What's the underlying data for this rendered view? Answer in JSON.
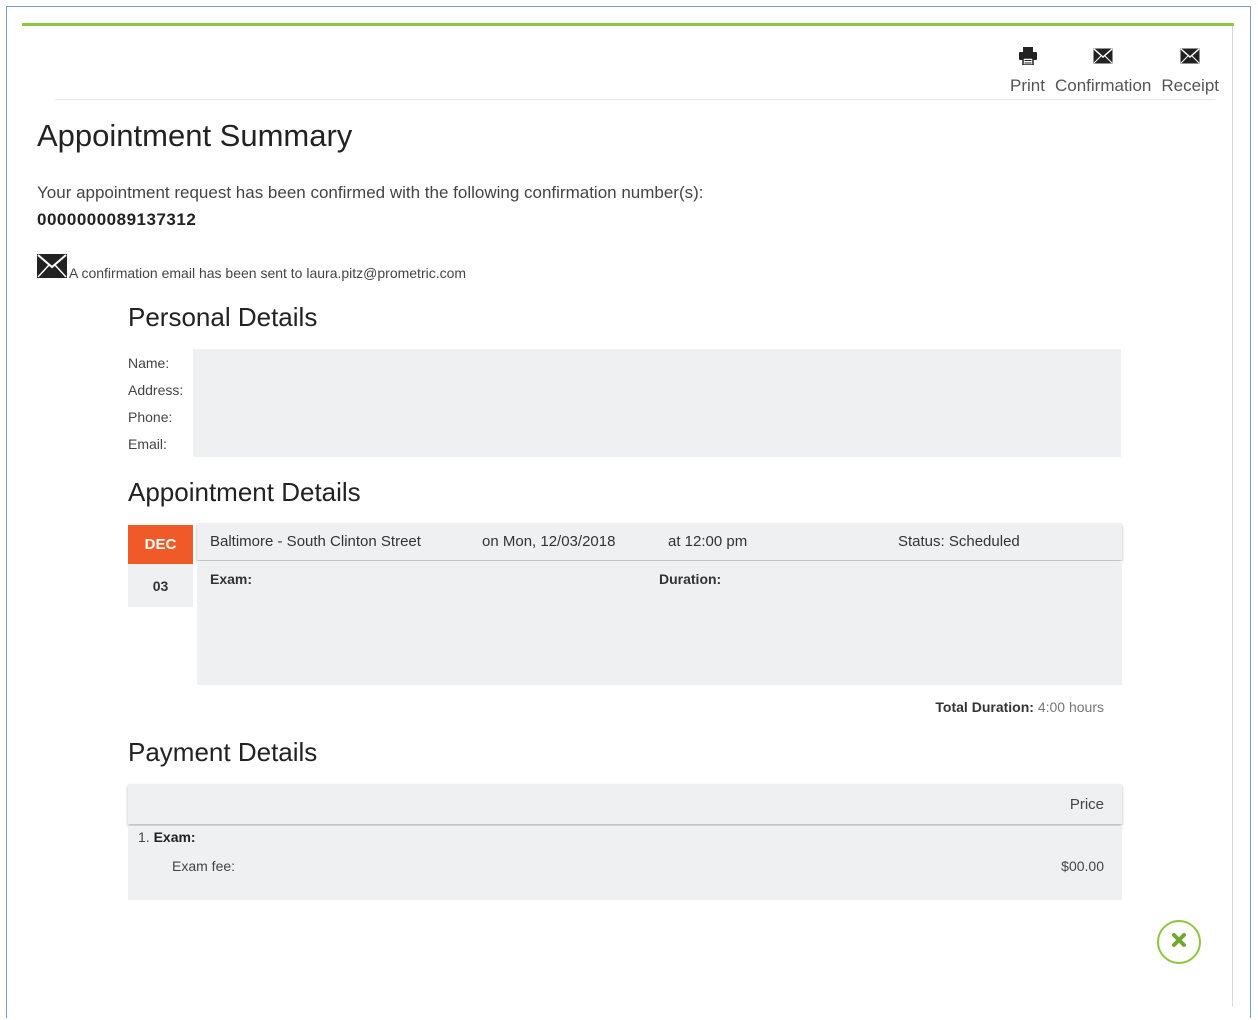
{
  "toolbar": {
    "print_label": "Print",
    "confirmation_label": "Confirmation",
    "receipt_label": "Receipt",
    "icons": [
      "printer-icon",
      "envelope-icon",
      "envelope-icon"
    ]
  },
  "page_title": "Appointment Summary",
  "confirmation": {
    "message": "Your appointment request has been confirmed with the following confirmation number(s):",
    "number": "0000000089137312",
    "email_note": "A confirmation email has been sent to laura.pitz@prometric.com"
  },
  "personal": {
    "title": "Personal Details",
    "name_label": "Name:",
    "address_label": "Address:",
    "phone_label": "Phone:",
    "email_label": "Email:"
  },
  "appointment": {
    "title": "Appointment Details",
    "month": "DEC",
    "day": "03",
    "location": "Baltimore - South Clinton Street",
    "date": "on Mon, 12/03/2018",
    "time": "at 12:00 pm",
    "status": "Status: Scheduled",
    "exam_label": "Exam:",
    "duration_label": "Duration:",
    "total_duration_label": "Total Duration:",
    "total_duration_value": "4:00 hours"
  },
  "payment": {
    "title": "Payment Details",
    "price_header": "Price",
    "item_number": "1.",
    "item_label": "Exam:",
    "fee_label": "Exam fee:",
    "fee_value": "$00.00"
  },
  "colors": {
    "accent_green": "#8dc63f",
    "badge_orange": "#f05a28",
    "panel_gray": "#eef0f2"
  }
}
